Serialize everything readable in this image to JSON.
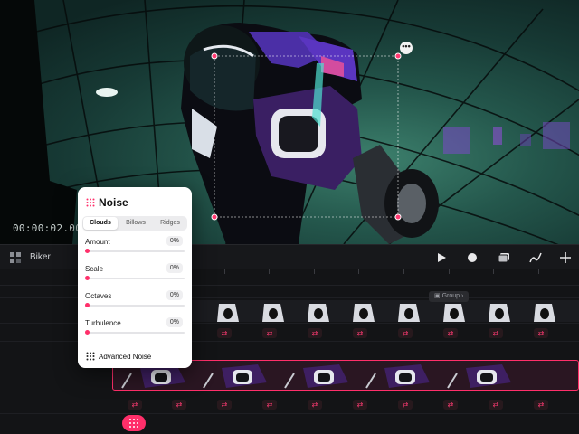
{
  "viewer": {
    "timecode": "00:00:02.001",
    "more_button": "•••"
  },
  "toolbar": {
    "project_name": "Biker",
    "buttons": [
      "play-icon",
      "record-icon",
      "layers-icon",
      "pen-icon",
      "add-icon"
    ]
  },
  "timeline": {
    "group_chip": "Group"
  },
  "noise_panel": {
    "title": "Noise",
    "tabs": [
      "Clouds",
      "Billows",
      "Ridges"
    ],
    "active_tab": "Clouds",
    "params": [
      {
        "label": "Amount",
        "value": "0%"
      },
      {
        "label": "Scale",
        "value": "0%"
      },
      {
        "label": "Octaves",
        "value": "0%"
      },
      {
        "label": "Turbulence",
        "value": "0%"
      }
    ],
    "advanced_label": "Advanced Noise"
  },
  "colors": {
    "accent": "#ff2f6a",
    "keyframe": "#ff3a72",
    "panel_bg": "#ffffff",
    "app_bg": "#131416",
    "scene_teal": "#2f6f62"
  }
}
